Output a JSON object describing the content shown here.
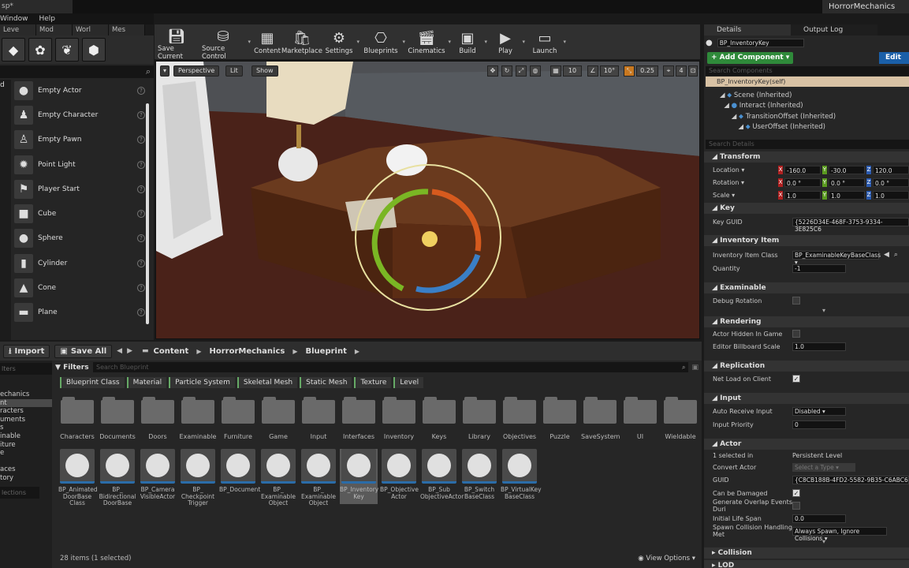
{
  "window": {
    "project_name": "HorrorMechanics",
    "tab_fragment": "sp*",
    "menu": [
      "Window",
      "Help"
    ]
  },
  "modes": {
    "tabs": [
      "Leve",
      "Mod",
      "Worl",
      "Mes"
    ],
    "actors": [
      "Empty Actor",
      "Empty Character",
      "Empty Pawn",
      "Point Light",
      "Player Start",
      "Cube",
      "Sphere",
      "Cylinder",
      "Cone",
      "Plane"
    ],
    "left_letter": "d"
  },
  "toolbar": {
    "items": [
      "Save Current",
      "Source Control",
      "Content",
      "Marketplace",
      "Settings",
      "Blueprints",
      "Cinematics",
      "Build",
      "Play",
      "Launch"
    ]
  },
  "viewport": {
    "perspective": "Perspective",
    "lit": "Lit",
    "show": "Show",
    "grid": "10",
    "rot": "10°",
    "scale": "0.25",
    "cam": "4"
  },
  "content_browser": {
    "import": "Import",
    "save_all": "Save All",
    "breadcrumb": [
      "Content",
      "HorrorMechanics",
      "Blueprint"
    ],
    "filters_label": "Filters",
    "search_placeholder": "Search Blueprint",
    "left_search": "lters",
    "left_search2": "lections",
    "left_tree": [
      "echanics",
      "nt",
      "racters",
      "uments",
      "s",
      "inable",
      "iture",
      "e",
      "",
      "aces",
      "tory"
    ],
    "filter_chips": [
      "Blueprint Class",
      "Material",
      "Particle System",
      "Skeletal Mesh",
      "Static Mesh",
      "Texture",
      "Level"
    ],
    "folders": [
      "Characters",
      "Documents",
      "Doors",
      "Examinable",
      "Furniture",
      "Game",
      "Input",
      "Interfaces",
      "Inventory",
      "Keys",
      "Library",
      "Objectives",
      "Puzzle",
      "SaveSystem",
      "UI",
      "Wieldable"
    ],
    "assets": [
      "BP_Animated\nDoorBase\nClass",
      "BP_\nBidirectional\nDoorBase",
      "BP_Camera\nVisibleActor",
      "BP_\nCheckpoint\nTrigger",
      "BP_Document",
      "BP_\nExaminable\nObject",
      "BP_\nExaminable\nObject",
      "BP_Inventory\nKey",
      "BP_Objective\nActor",
      "BP_Sub\nObjectiveActor",
      "BP_Switch\nBaseClass",
      "BP_VirtualKey\nBaseClass"
    ],
    "status": "28 items (1 selected)",
    "view_options": "View Options"
  },
  "details": {
    "tab_details": "Details",
    "tab_output": "Output Log",
    "name": "BP_InventoryKey",
    "add_component": "+ Add Component",
    "edit": "Edit",
    "search_components": "Search Components",
    "self_row": "BP_InventoryKey(self)",
    "components": [
      "Scene (Inherited)",
      "Interact (Inherited)",
      "TransitionOffset (Inherited)",
      "UserOffset (Inherited)"
    ],
    "search_details": "Search Details",
    "transform": {
      "title": "Transform",
      "location_label": "Location",
      "rotation_label": "Rotation",
      "scale_label": "Scale",
      "location": [
        "-160.0",
        "-30.0",
        "120.0"
      ],
      "rotation": [
        "0.0 °",
        "0.0 °",
        "0.0 °"
      ],
      "scale": [
        "1.0",
        "1.0",
        "1.0"
      ]
    },
    "key": {
      "title": "Key",
      "guid_label": "Key GUID",
      "guid": "{5226D34E-468F-3753-9334-3E825C6"
    },
    "inventory": {
      "title": "Inventory Item",
      "class_label": "Inventory Item Class",
      "class_value": "BP_ExaminableKeyBaseClass",
      "qty_label": "Quantity",
      "qty": "-1"
    },
    "examinable": {
      "title": "Examinable",
      "debug_label": "Debug Rotation"
    },
    "rendering": {
      "title": "Rendering",
      "hidden_label": "Actor Hidden In Game",
      "billboard_label": "Editor Billboard Scale",
      "billboard": "1.0"
    },
    "replication": {
      "title": "Replication",
      "net_label": "Net Load on Client"
    },
    "input": {
      "title": "Input",
      "auto_label": "Auto Receive Input",
      "auto_value": "Disabled",
      "priority_label": "Input Priority",
      "priority": "0"
    },
    "actor": {
      "title": "Actor",
      "selected_label": "1 selected in",
      "selected_value": "Persistent Level",
      "convert_label": "Convert Actor",
      "convert_value": "Select a Type",
      "guid_label": "GUID",
      "guid": "{C8CB188B-4FD2-5582-9B35-C6ABC6",
      "damaged_label": "Can be Damaged",
      "overlap_label": "Generate Overlap Events Duri",
      "life_label": "Initial Life Span",
      "life": "0.0",
      "spawn_label": "Spawn Collision Handling Met",
      "spawn_value": "Always Spawn, Ignore Collisions"
    },
    "collision": "Collision",
    "lod": "LOD"
  }
}
